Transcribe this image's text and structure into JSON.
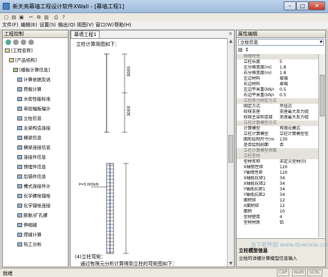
{
  "window": {
    "title": "新天亮幕墙工程设计软件XWall - [幕墙工程1]"
  },
  "menu": [
    "文件(F)",
    "编辑(E)",
    "设置(S)",
    "输出(Q)",
    "视图(V)",
    "窗口(W)",
    "帮助(H)"
  ],
  "left_panel": {
    "title": "工程控制",
    "tree": [
      {
        "label": "[工程名称]",
        "level": 0
      },
      {
        "label": "[产品结构]",
        "level": 1
      },
      {
        "label": "[模板计算信息]",
        "level": 2
      },
      {
        "label": "计算依据及说",
        "level": 3
      },
      {
        "label": "荷载计算",
        "level": 3
      },
      {
        "label": "水密性能标准",
        "level": 3
      },
      {
        "label": "单层幅板幅计",
        "level": 3
      },
      {
        "label": "立柱信息",
        "level": 3
      },
      {
        "label": "主梁构造连接",
        "level": 3
      },
      {
        "label": "横梁信息",
        "level": 3
      },
      {
        "label": "横梁连接信息",
        "level": 3
      },
      {
        "label": "连接件信息",
        "level": 3
      },
      {
        "label": "预埋件信息",
        "level": 3
      },
      {
        "label": "后锚件信息",
        "level": 3
      },
      {
        "label": "槽式连接件计",
        "level": 3
      },
      {
        "label": "化学螺栓锚栓",
        "level": 3
      },
      {
        "label": "化学锚栓连接",
        "level": 3
      },
      {
        "label": "膨胀/扩孔螺",
        "level": 3
      },
      {
        "label": "伸缩缝",
        "level": 3
      },
      {
        "label": "焊缝计算",
        "level": 3
      },
      {
        "label": "热工分析",
        "level": 3
      }
    ]
  },
  "document": {
    "tab": "幕墙工程1",
    "heading": "立柱计算简图如下：",
    "dim_top": [
      "3000",
      "3000"
    ],
    "labels": [
      "P=5.000kN"
    ],
    "section_heading": "(4)立柱弯矩：",
    "section_text": "通过有限元分析计算得到立柱的弯矩图如下："
  },
  "right_panel": {
    "title": "属性编辑",
    "selector": "立柱信息",
    "categories": [
      {
        "name": "物理特性",
        "rows": [
          [
            "立柱长度",
            "5"
          ],
          [
            "左分格宽度(m)",
            "1.8"
          ],
          [
            "右分格宽度(m)",
            "1.8"
          ],
          [
            "左边材料",
            "玻璃"
          ],
          [
            "右边材料",
            "玻璃"
          ],
          [
            "左边平米重(kN/m²)",
            "0.5"
          ],
          [
            "右边平米重(kN/m²)",
            "0.5"
          ]
        ]
      },
      {
        "name": "立柱受力固定方式",
        "rows": [
          [
            "固定方式",
            "吊挂式"
          ],
          [
            "校核支座",
            "支座最大反力组"
          ],
          [
            "校核主梁和连接",
            "支座最大反力组"
          ]
        ]
      },
      {
        "name": "立柱计算模型方式",
        "rows": [
          [
            "计算模型",
            "有限元模式"
          ],
          [
            "立柱计算模型",
            "立柱计算模型信"
          ],
          [
            "图形绘制尺寸(mm)",
            "130"
          ],
          [
            "是否绘制剖面",
            "否"
          ]
        ]
      },
      {
        "name": "立柱计算模型参数",
        "rows": []
      },
      {
        "name": "立柱型材",
        "rows": [
          [
            "型材名称",
            "未定义型材(0)"
          ],
          [
            "X轴惯性矩",
            "120"
          ],
          [
            "Y轴惯性矩",
            "120"
          ],
          [
            "X轴抵抗矩1",
            "34"
          ],
          [
            "X轴抵抗矩2",
            "34"
          ],
          [
            "Y轴抵抗矩1",
            "34"
          ],
          [
            "Y轴抵抗矩2",
            "34"
          ],
          [
            "面积矩",
            "12"
          ],
          [
            "X面积矩",
            "12"
          ],
          [
            "面积",
            "10"
          ],
          [
            "型材壁厚",
            "4"
          ],
          [
            "型材材质",
            "铝"
          ]
        ]
      }
    ],
    "description_title": "立柱模型信息",
    "description_text": "立柱的详细计算模型信息输入"
  },
  "statusbar": {
    "left": "就绪",
    "indicators": [
      "CAP",
      "NUM",
      "SCRL"
    ]
  },
  "watermark": "当下软件园 www.downxia.com"
}
